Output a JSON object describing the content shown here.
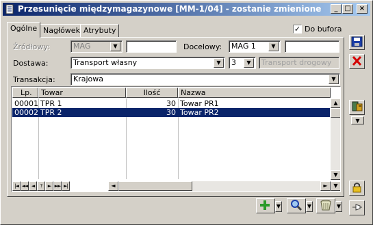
{
  "window": {
    "title": "Przesunięcie międzymagazynowe [MM-1/04] - zostanie zmienione",
    "min_glyph": "_",
    "max_glyph": "□",
    "close_glyph": "×"
  },
  "tabs": [
    {
      "label": "Ogólne",
      "active": true
    },
    {
      "label": "Nagłówek",
      "active": false
    },
    {
      "label": "Atrybuty",
      "active": false
    }
  ],
  "do_bufora": {
    "label": "Do bufora",
    "checked": true
  },
  "form": {
    "zrodlowy": {
      "label": "Źródłowy:",
      "value": "MAG",
      "extra": ""
    },
    "docelowy": {
      "label": "Docelowy:",
      "value": "MAG 1",
      "extra": ""
    },
    "dostawa": {
      "label": "Dostawa:",
      "value": "Transport własny",
      "number": "3",
      "placeholder": "Transport drogowy"
    },
    "transakcja": {
      "label": "Transakcja:",
      "value": "Krajowa"
    }
  },
  "grid": {
    "columns": [
      "Lp.",
      "Towar",
      "Ilość",
      "Nazwa"
    ],
    "rows": [
      {
        "lp": "00001",
        "towar": "TPR 1",
        "ilosc": "30",
        "nazwa": "Towar PR1",
        "selected": false
      },
      {
        "lp": "00002",
        "towar": "TPR 2",
        "ilosc": "30",
        "nazwa": "Towar PR2",
        "selected": true
      }
    ],
    "nav_buttons": [
      "|◄",
      "◄◄",
      "◄",
      "?",
      "►",
      "►►",
      "►|"
    ]
  },
  "colors": {
    "accent": "#0a246a",
    "face": "#d4d0c8",
    "save": "#1c3fa8",
    "delete": "#d40000",
    "add": "#2a9a2a"
  },
  "icons": {
    "save": "floppy-disk-icon",
    "delete": "red-x-icon",
    "transfer": "document-transfer-icon",
    "lock": "padlock-icon",
    "add": "green-plus-icon",
    "search": "magnifier-icon",
    "trash": "trash-bin-icon",
    "pin": "pin-icon"
  }
}
